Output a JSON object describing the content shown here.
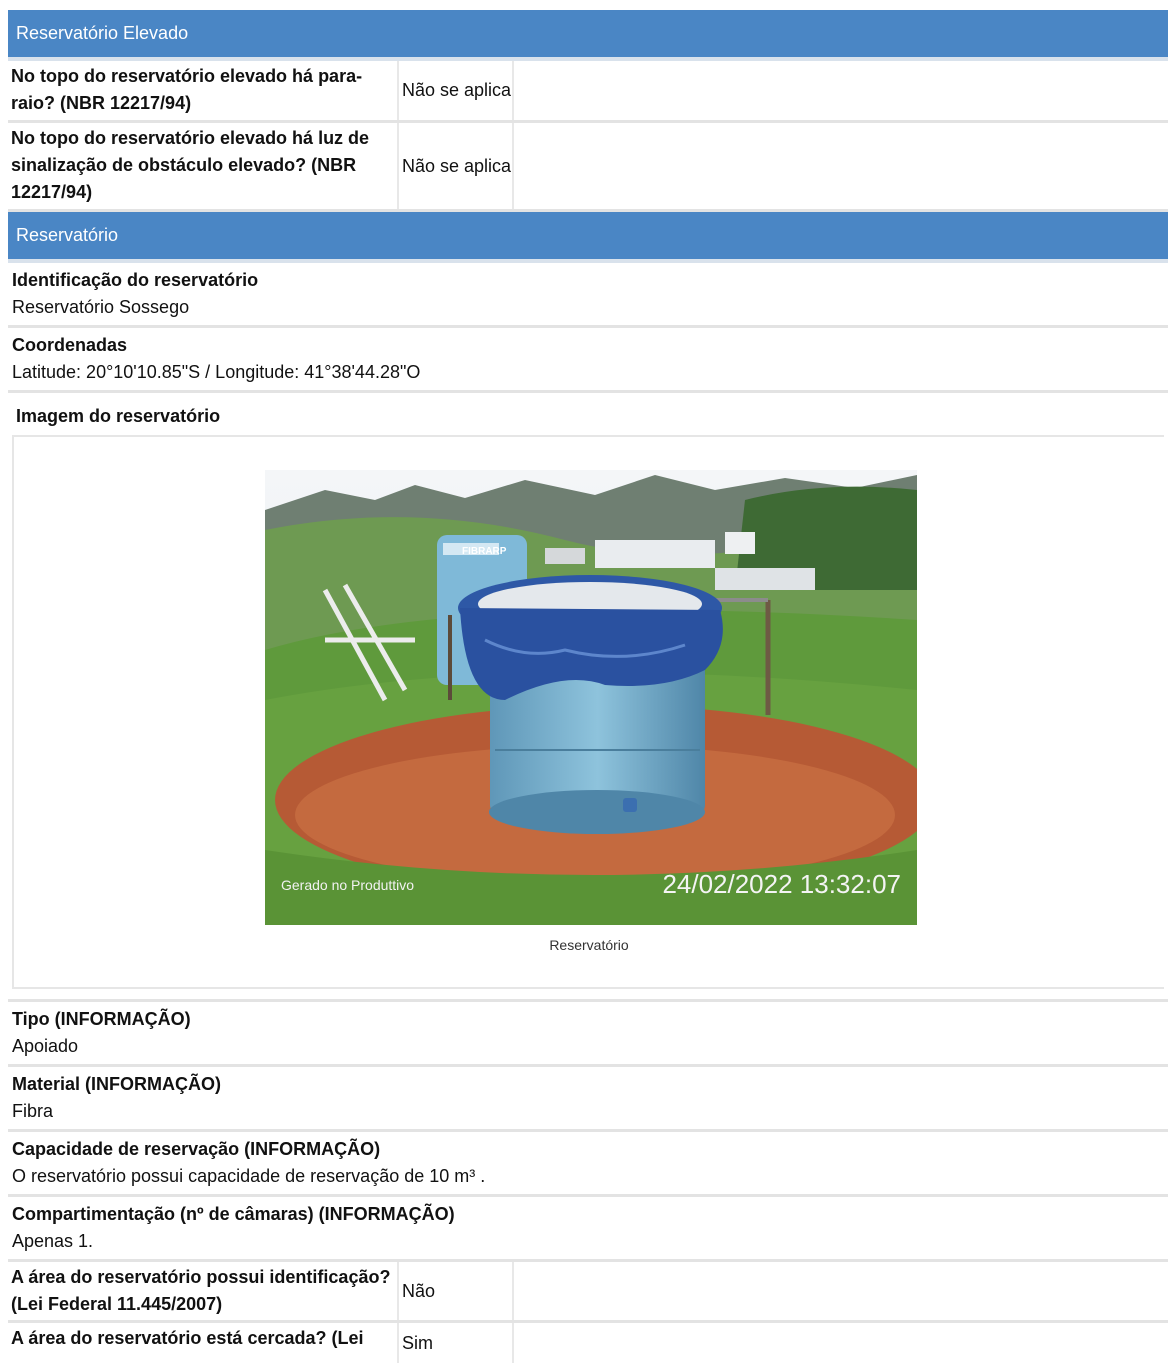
{
  "section1": {
    "title": "Reservatório Elevado",
    "rows": [
      {
        "question": "No topo do reservatório elevado há para-raio? (NBR 12217/94)",
        "answer": "Não se aplica"
      },
      {
        "question": "No topo do reservatório elevado há luz de sinalização de obstáculo elevado? (NBR 12217/94)",
        "answer": "Não se aplica"
      }
    ]
  },
  "section2": {
    "title": "Reservatório",
    "identificacao": {
      "label": "Identificação do reservatório",
      "value": "Reservatório Sossego"
    },
    "coordenadas": {
      "label": "Coordenadas",
      "value": "Latitude: 20°10'10.85\"S / Longitude: 41°38'44.28\"O"
    },
    "imagem": {
      "label": "Imagem do reservatório",
      "watermark": "Gerado no Produttivo",
      "timestamp": "24/02/2022 13:32:07",
      "tank_text": "FIBRARP",
      "caption": "Reservatório"
    },
    "tipo": {
      "label": "Tipo (INFORMAÇÃO)",
      "value": "Apoiado"
    },
    "material": {
      "label": "Material (INFORMAÇÃO)",
      "value": "Fibra"
    },
    "capacidade": {
      "label": "Capacidade de reservação (INFORMAÇÃO)",
      "value": "O reservatório possui capacidade de reservação de 10 m³ ."
    },
    "compartimentacao": {
      "label": "Compartimentação (nº de câmaras) (INFORMAÇÃO)",
      "value": "Apenas 1."
    },
    "rows": [
      {
        "question": "A área do reservatório possui identificação? (Lei Federal 11.445/2007)",
        "answer": "Não"
      },
      {
        "question": "A área do reservatório está cercada? (Lei",
        "answer": "Sim"
      }
    ]
  }
}
